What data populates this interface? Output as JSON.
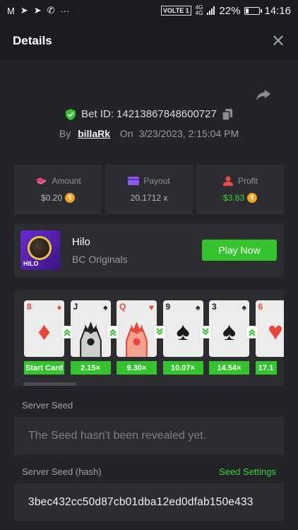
{
  "statusbar": {
    "volte": "VOLTE 1",
    "net": "4G",
    "net2": "4G",
    "battery": "22%",
    "battery_level": 0.22,
    "time": "14:16"
  },
  "header": {
    "title": "Details",
    "close": "✕"
  },
  "bet": {
    "label": "Bet ID:",
    "id": "14213867848600727",
    "by": "By",
    "user": "billaRk",
    "on": "On",
    "date": "3/23/2023, 2:15:04 PM"
  },
  "stats": {
    "amount": {
      "label": "Amount",
      "value": "$0.20"
    },
    "payout": {
      "label": "Payout",
      "value": "20.1712 x"
    },
    "profit": {
      "label": "Profit",
      "value": "$3.83"
    }
  },
  "game": {
    "name": "Hilo",
    "provider": "BC Originals",
    "thumb_label": "HILO",
    "play_label": "Play Now"
  },
  "cards": [
    {
      "rank": "8",
      "suit": "♦",
      "color": "red",
      "badge": "Start Card"
    },
    {
      "rank": "J",
      "suit": "♠",
      "color": "blk",
      "badge": "2.15×",
      "arrow": "up"
    },
    {
      "rank": "Q",
      "suit": "♥",
      "color": "red",
      "badge": "9.30×",
      "arrow": "up"
    },
    {
      "rank": "9",
      "suit": "♠",
      "color": "blk",
      "badge": "10.07×",
      "arrow": "down"
    },
    {
      "rank": "3",
      "suit": "♠",
      "color": "blk",
      "badge": "14.54×",
      "arrow": "down"
    },
    {
      "rank": "6",
      "suit": "♥",
      "color": "red",
      "badge": "17.1",
      "arrow": "up"
    }
  ],
  "server_seed": {
    "label": "Server Seed",
    "value": "The Seed hasn't been revealed yet."
  },
  "server_seed_hash": {
    "label": "Server Seed (hash)",
    "settings": "Seed Settings",
    "value": "3bec432cc50d87cb01dba12ed0dfab150e433"
  },
  "coin_symbol": "₹",
  "colors": {
    "green": "#36c42e",
    "panel": "#2c2d31",
    "bg": "#232427"
  }
}
